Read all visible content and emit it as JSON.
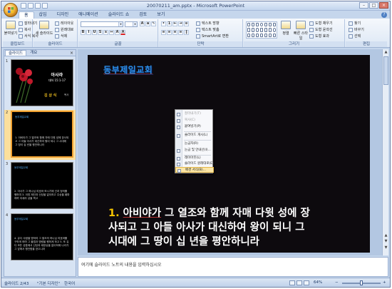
{
  "window": {
    "title": "20070211_am.pptx - Microsoft PowerPoint",
    "controls": {
      "minimize": "–",
      "maximize": "□",
      "close": "×"
    }
  },
  "ribbon": {
    "tabs": [
      "홈",
      "삽입",
      "디자인",
      "애니메이션",
      "슬라이드 쇼",
      "검토",
      "보기"
    ],
    "active_tab": 0,
    "groups": {
      "clipboard": {
        "label": "클립보드",
        "paste": "붙여넣기",
        "cut": "잘라내기",
        "copy": "복사",
        "format_painter": "서식 복사"
      },
      "slides": {
        "label": "슬라이드",
        "new_slide": "새 슬라이드",
        "layout": "레이아웃",
        "reset": "원래대로",
        "delete": "삭제"
      },
      "font": {
        "label": "글꼴"
      },
      "paragraph": {
        "label": "단락",
        "text_direction": "텍스트 방향",
        "align_text": "텍스트 맞춤",
        "smartart": "SmartArt로 변환"
      },
      "drawing": {
        "label": "그리기",
        "arrange": "정렬",
        "quick_styles": "빠른 스타일",
        "shape_fill": "도형 채우기",
        "shape_outline": "도형 윤곽선",
        "shape_effects": "도형 효과"
      },
      "editing": {
        "label": "편집",
        "find": "찾기",
        "replace": "바꾸기",
        "select": "선택"
      }
    }
  },
  "left_pane": {
    "tabs": [
      "슬라이드",
      "개요"
    ],
    "active_tab": 0,
    "close": "×",
    "slides": [
      {
        "num": "1",
        "name": "아사랴",
        "ref": "대하 15:1-17",
        "preacher": "김 상 식",
        "suffix": "목사"
      },
      {
        "num": "2",
        "head": "동부제일교회",
        "text": "1. 아비야가 그 열조와 함께 자매 다윗 성에 장사되고 그 아들 아사가 대신하여 왕이 되니 그 시대에 그 땅이 십 년을 평안하니라"
      },
      {
        "num": "3",
        "head": "동부제일교회",
        "text": "2. 아사가 그 하나님 여호와 보시기에 선과 정의를 행하여 3. 이방 제단과 산당을 없이하고 주상을 훼파하며 아세라 상을 찍고"
      },
      {
        "num": "4",
        "head": "동부제일교회",
        "text": "4. 유다 사람을 명하여 그 열조의 하나님 여호와를 구하게 하며 그 율법과 명령을 행하게 하고 5. 또 유다 모든 성읍에서 산당과 태양상을 없이하매 나라가 그 앞에서 평안함을 얻으니라"
      }
    ]
  },
  "slide": {
    "church": "동부제일교회",
    "verse_number": "1.",
    "verse_name": "아비야가",
    "verse_line1": " 그 열조와 함께 자매 다윗 성에 장",
    "verse_line2": "사되고 그 아들 아사가 대신하여 왕이 되니 그",
    "verse_line3": "시대에 그 땅이 십 년을 평안하니라"
  },
  "context_menu": {
    "items": [
      {
        "label": "잘라내기(T)",
        "disabled": true
      },
      {
        "label": "복사(C)",
        "disabled": true
      },
      {
        "label": "붙여넣기(P)",
        "disabled": false
      },
      {
        "label": "슬라이드 개시(L)",
        "disabled": false
      },
      {
        "label": "눈금자(R)",
        "disabled": false
      },
      {
        "label": "눈금 및 안내선(I)...",
        "disabled": false
      },
      {
        "label": "레이아웃(L)",
        "disabled": false
      },
      {
        "label": "슬라이드 원래대로(E)",
        "disabled": false
      },
      {
        "label": "배경 서식(B)...",
        "disabled": false,
        "highlighted": true
      }
    ]
  },
  "notes": {
    "placeholder": "여기에 슬라이드 노트의 내용을 입력하십시오"
  },
  "status_bar": {
    "slide_info": "슬라이드 2/43",
    "theme": "\"기본 디자인\"",
    "language": "한국어",
    "zoom": "64%",
    "zoom_level": 0.5
  },
  "colors": {
    "accent": "#2b8fe6",
    "verse_number": "#f5c400",
    "slide_bg": "#0d0a0e",
    "selected_thumb": "#f0a030"
  }
}
